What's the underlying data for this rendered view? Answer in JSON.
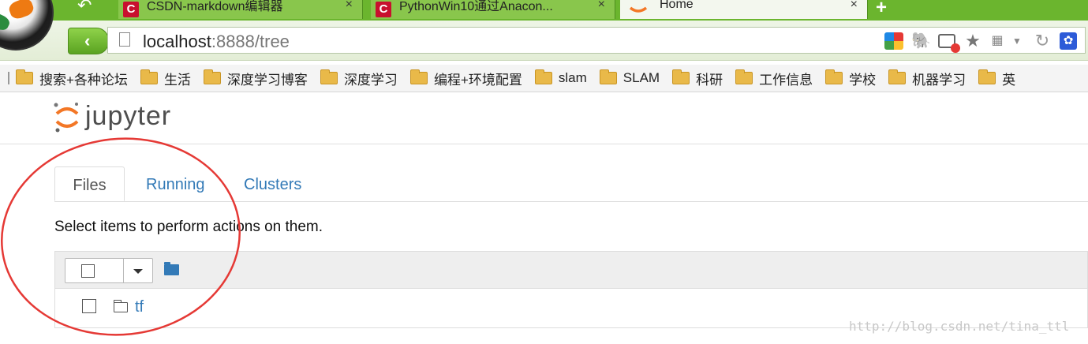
{
  "browser": {
    "tabs": [
      {
        "label": "CSDN-markdown编辑器",
        "favicon": "C"
      },
      {
        "label": "PythonWin10通过Anacon...",
        "favicon": "C"
      },
      {
        "label": "Home"
      }
    ],
    "tab_close": "×",
    "new_tab": "+",
    "url_host": "localhost",
    "url_rest": ":8888/tree",
    "bookmarks": [
      "搜索+各种论坛",
      "生活",
      "深度学习博客",
      "深度学习",
      "编程+环境配置",
      "slam",
      "SLAM",
      "科研",
      "工作信息",
      "学校",
      "机器学习",
      "英"
    ]
  },
  "jupyter": {
    "wordmark": "jupyter",
    "tabs": [
      {
        "label": "Files",
        "active": true
      },
      {
        "label": "Running",
        "active": false
      },
      {
        "label": "Clusters",
        "active": false
      }
    ],
    "help_text": "Select items to perform actions on them.",
    "items": [
      {
        "name": "tf",
        "type": "folder"
      }
    ]
  },
  "watermark": "http://blog.csdn.net/tina_ttl",
  "colors": {
    "chrome_green": "#6bb52e",
    "link_blue": "#337ab7",
    "jupyter_orange": "#f37726",
    "annotation_red": "#e53935"
  },
  "icons": [
    "soccer-ball-icon",
    "back-icon",
    "page-icon",
    "folder-icon",
    "caret-down-icon",
    "star-icon",
    "reload-icon"
  ]
}
